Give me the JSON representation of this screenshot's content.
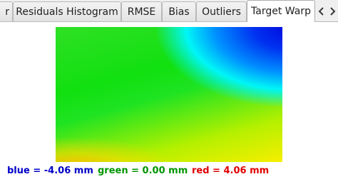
{
  "tabs": [
    {
      "label": "r",
      "active": false
    },
    {
      "label": "Residuals Histogram",
      "active": false
    },
    {
      "label": "RMSE",
      "active": false
    },
    {
      "label": "Bias",
      "active": false
    },
    {
      "label": "Outliers",
      "active": false
    },
    {
      "label": "Target Warp",
      "active": true
    }
  ],
  "legend": {
    "blue": {
      "text": "blue = -4.06 mm",
      "color": "#0000c8"
    },
    "green": {
      "text": "green = 0.00 mm",
      "color": "#009600"
    },
    "red": {
      "text": "red = 4.06 mm",
      "color": "#e00000"
    }
  },
  "icons": {
    "scroll_left": "chevron-left-icon",
    "scroll_right": "chevron-right-icon"
  }
}
